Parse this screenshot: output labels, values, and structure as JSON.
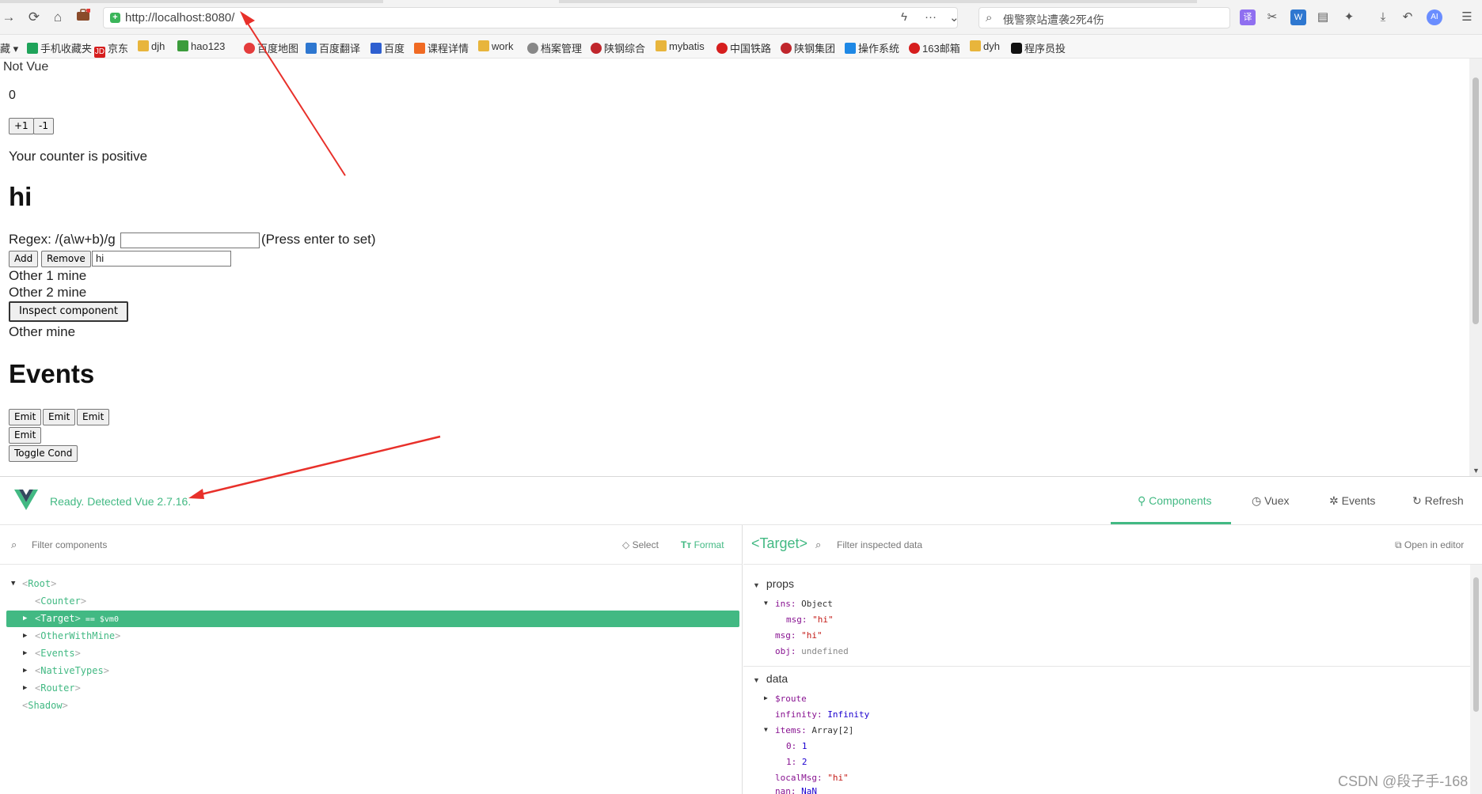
{
  "browser": {
    "url": "http://localhost:8080/",
    "search_text": "俄警察站遭袭2死4伤",
    "bookmarks": [
      "藏",
      "手机收藏夹",
      "京东",
      "djh",
      "hao123",
      "百度地图",
      "百度翻译",
      "百度",
      "课程详情",
      "work",
      "档案管理",
      "陕钢综合",
      "mybatis",
      "中国铁路",
      "陕钢集团",
      "操作系统",
      "163邮箱",
      "dyh",
      "程序员投"
    ]
  },
  "page": {
    "title": "Not Vue",
    "counter_value": "0",
    "plus_label": "+1",
    "minus_label": "-1",
    "counter_msg": "Your counter is positive",
    "heading_hi": "hi",
    "regex_label": "Regex: /(a\\w+b)/g",
    "regex_hint": "(Press enter to set)",
    "add_label": "Add",
    "remove_label": "Remove",
    "item_input_value": "hi",
    "other1": "Other 1 mine",
    "other2": "Other 2 mine",
    "inspect_label": "Inspect component",
    "other_mine": "Other mine",
    "events_heading": "Events",
    "emit_label": "Emit",
    "toggle_label": "Toggle Cond"
  },
  "devtools": {
    "status": "Ready. Detected Vue 2.7.16.",
    "tabs": {
      "components": "Components",
      "vuex": "Vuex",
      "events": "Events",
      "refresh": "Refresh"
    },
    "left": {
      "filter_placeholder": "Filter components",
      "select_label": "Select",
      "format_label": "Format",
      "tree": [
        {
          "name": "Root",
          "arrow": "▼",
          "indent": 0
        },
        {
          "name": "Counter",
          "arrow": "",
          "indent": 1
        },
        {
          "name": "Target",
          "arrow": "▶",
          "indent": 1,
          "selected": true,
          "vm": "== $vm0"
        },
        {
          "name": "OtherWithMine",
          "arrow": "▶",
          "indent": 1
        },
        {
          "name": "Events",
          "arrow": "▶",
          "indent": 1
        },
        {
          "name": "NativeTypes",
          "arrow": "▶",
          "indent": 1
        },
        {
          "name": "Router",
          "arrow": "▶",
          "indent": 1
        },
        {
          "name": "Shadow",
          "arrow": "",
          "indent": 0
        }
      ]
    },
    "right": {
      "title": "<Target>",
      "filter_placeholder": "Filter inspected data",
      "open_editor": "Open in editor",
      "props_label": "props",
      "data_label": "data",
      "props": [
        {
          "key": "ins:",
          "val": "Object",
          "type": "obj",
          "arrow": "▼",
          "depth": 0
        },
        {
          "key": "msg:",
          "val": "\"hi\"",
          "type": "str",
          "depth": 1
        },
        {
          "key": "msg:",
          "val": "\"hi\"",
          "type": "str",
          "depth": 0
        },
        {
          "key": "obj:",
          "val": "undefined",
          "type": "undef",
          "depth": 0
        }
      ],
      "data": [
        {
          "key": "$route",
          "val": "",
          "type": "obj",
          "arrow": "▶",
          "depth": 0
        },
        {
          "key": "infinity:",
          "val": "Infinity",
          "type": "num",
          "depth": 0
        },
        {
          "key": "items:",
          "val": "Array[2]",
          "type": "obj",
          "arrow": "▼",
          "depth": 0
        },
        {
          "key": "0:",
          "val": "1",
          "type": "num",
          "depth": 1
        },
        {
          "key": "1:",
          "val": "2",
          "type": "num",
          "depth": 1
        },
        {
          "key": "localMsg:",
          "val": "\"hi\"",
          "type": "str",
          "depth": 0
        },
        {
          "key": "nan:",
          "val": "NaN",
          "type": "num",
          "depth": 0
        }
      ]
    }
  },
  "watermark": "CSDN @段子手-168",
  "colors": {
    "vue_green": "#42b983",
    "annotation_red": "#e8302a"
  }
}
